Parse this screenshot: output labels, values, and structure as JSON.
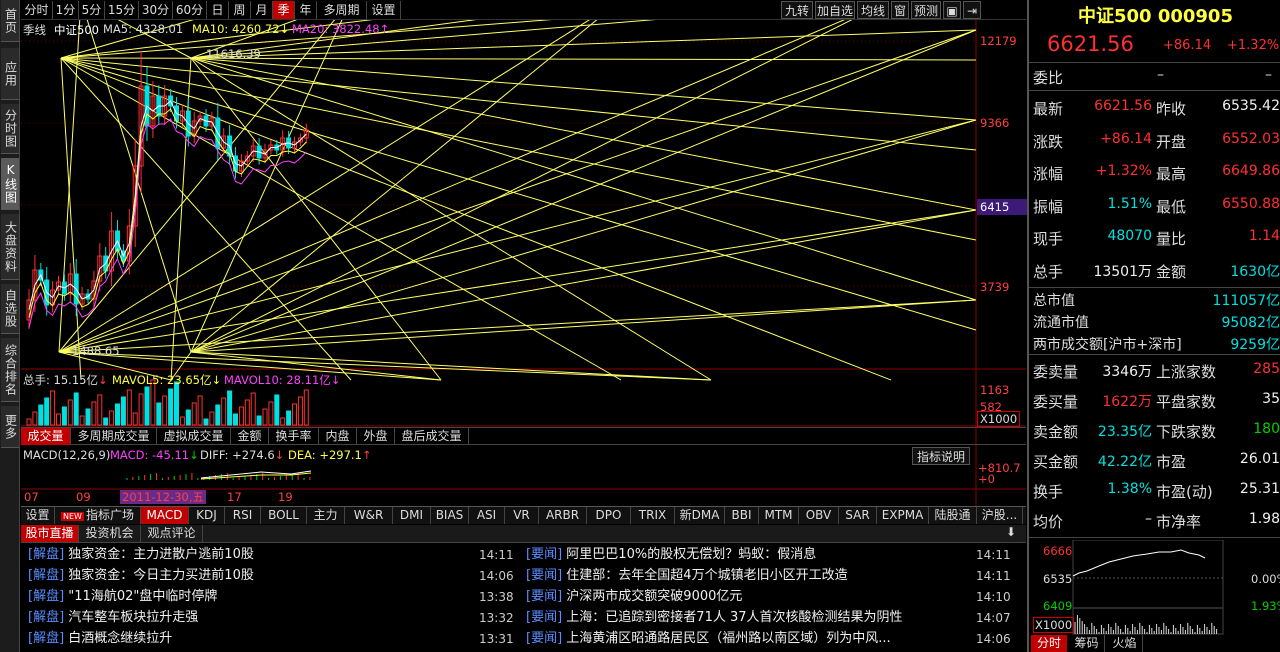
{
  "left_rail": {
    "tabs": [
      "首页",
      "应用",
      "分时图",
      "K线图",
      "大盘资料",
      "自选股",
      "综合排名",
      "更多"
    ]
  },
  "periods": [
    "分时",
    "1分",
    "5分",
    "15分",
    "30分",
    "60分",
    "日",
    "周",
    "月",
    "季",
    "年",
    "多周期",
    "设置"
  ],
  "active_period": "季",
  "toolbar_right": [
    "九转",
    "加自选",
    "均线",
    "窗",
    "预测"
  ],
  "chart": {
    "prefix": "季线",
    "name": "中证500",
    "ma5": "MA5: 4328.01",
    "ma10": "MA10: 4260.72",
    "ma20": "MA20: 3822.48",
    "high_label": "11616.39",
    "low_label": "1488.65",
    "price_axis": [
      "12179",
      "9366",
      "6415",
      "3739"
    ],
    "vol_sum": "总手: 15.15亿",
    "mavol5": "MAVOL5: 23.65亿",
    "mavol10": "MAVOL10: 28.11亿",
    "vol_axis": [
      "1163",
      "582"
    ],
    "vol_unit": "X1000",
    "macd_label": "MACD(12,26,9)",
    "macd_val": "MACD: -45.11",
    "diff_val": "DIFF: +274.6",
    "dea_val": "DEA: +297.1",
    "macd_axis_top": "+810.7",
    "macd_axis_zero": "+0",
    "indicator_explain": "指标说明",
    "date_ticks": [
      "07",
      "09",
      "17",
      "19"
    ],
    "cursor_date": "2011-12-30,五"
  },
  "vol_tabs": [
    "成交量",
    "多周期成交量",
    "虚拟成交量",
    "金额",
    "换手率",
    "内盘",
    "外盘",
    "盘后成交量"
  ],
  "indicator_tabs": [
    "设置",
    "指标广场",
    "MACD",
    "KDJ",
    "RSI",
    "BOLL",
    "主力",
    "W&R",
    "DMI",
    "BIAS",
    "ASI",
    "VR",
    "ARBR",
    "DPO",
    "TRIX",
    "新DMA",
    "BBI",
    "MTM",
    "OBV",
    "SAR",
    "EXPMA",
    "陆股通",
    "沪股..."
  ],
  "new_badge": "NEW",
  "news_tabs": [
    "股市直播",
    "投资机会",
    "观点评论"
  ],
  "news_left": [
    {
      "cat": "[解盘]",
      "title": "独家资金：主力进散户逃前10股",
      "time": "14:11"
    },
    {
      "cat": "[解盘]",
      "title": "独家资金：今日主力买进前10股",
      "time": "14:06"
    },
    {
      "cat": "[解盘]",
      "title": "\"11海航02\"盘中临时停牌",
      "time": "13:38"
    },
    {
      "cat": "[解盘]",
      "title": "汽车整车板块拉升走强",
      "time": "13:32"
    },
    {
      "cat": "[解盘]",
      "title": "白酒概念继续拉升",
      "time": "13:31"
    }
  ],
  "news_right": [
    {
      "cat": "[要闻]",
      "title": "阿里巴巴10%的股权无偿划？蚂蚁：假消息",
      "time": "14:11"
    },
    {
      "cat": "[要闻]",
      "title": "住建部：去年全国超4万个城镇老旧小区开工改造",
      "time": "14:11"
    },
    {
      "cat": "[要闻]",
      "title": "沪深两市成交额突破9000亿元",
      "time": "14:10"
    },
    {
      "cat": "[要闻]",
      "title": "上海：已追踪到密接者71人 37人首次核酸检测结果为阴性",
      "time": "14:07"
    },
    {
      "cat": "[要闻]",
      "title": "上海黄浦区昭通路居民区（福州路以南区域）列为中风...",
      "time": "14:06"
    }
  ],
  "quote": {
    "title": "中证500 000905",
    "price": "6621.56",
    "change": "+86.14",
    "pct": "+1.32%",
    "weibi_label": "委比",
    "weibi_val": "–",
    "weibi_val2": "–",
    "rows": [
      {
        "l1": "最新",
        "v1": "6621.56",
        "c1": "red",
        "l2": "昨收",
        "v2": "6535.42",
        "c2": "white"
      },
      {
        "l1": "涨跌",
        "v1": "+86.14",
        "c1": "red",
        "l2": "开盘",
        "v2": "6552.03",
        "c2": "red"
      },
      {
        "l1": "涨幅",
        "v1": "+1.32%",
        "c1": "red",
        "l2": "最高",
        "v2": "6649.86",
        "c2": "red"
      },
      {
        "l1": "振幅",
        "v1": "1.51%",
        "c1": "cyan",
        "l2": "最低",
        "v2": "6550.88",
        "c2": "red"
      },
      {
        "l1": "现手",
        "v1": "48070",
        "c1": "cyan",
        "l2": "量比",
        "v2": "1.14",
        "c2": "red"
      },
      {
        "l1": "总手",
        "v1": "13501万",
        "c1": "white",
        "l2": "金额",
        "v2": "1630亿",
        "c2": "cyan"
      }
    ],
    "market": [
      {
        "l": "总市值",
        "v": "111057亿"
      },
      {
        "l": "流通市值",
        "v": "95082亿"
      },
      {
        "l": "两市成交额[沪市+深市]",
        "v": "9259亿"
      }
    ],
    "rows2": [
      {
        "l1": "委卖量",
        "v1": "3346万",
        "c1": "white",
        "l2": "上涨家数",
        "v2": "285",
        "c2": "red"
      },
      {
        "l1": "委买量",
        "v1": "1622万",
        "c1": "red",
        "l2": "平盘家数",
        "v2": "35",
        "c2": "white"
      },
      {
        "l1": "卖金额",
        "v1": "23.35亿",
        "c1": "cyan",
        "l2": "下跌家数",
        "v2": "180",
        "c2": "green"
      },
      {
        "l1": "买金额",
        "v1": "42.22亿",
        "c1": "cyan",
        "l2": "市盈",
        "v2": "26.01",
        "c2": "white"
      },
      {
        "l1": "换手",
        "v1": "1.38%",
        "c1": "cyan",
        "l2": "市盈(动)",
        "v2": "25.31",
        "c2": "white"
      },
      {
        "l1": "均价",
        "v1": "–",
        "c1": "white",
        "l2": "市净率",
        "v2": "1.98",
        "c2": "white"
      }
    ],
    "mini_top": "6666",
    "mini_mid": "6535",
    "mini_bot": "6409",
    "mini_pct_mid": "0.00%",
    "mini_pct_bot": "1.93%",
    "mini_unit": "X1000",
    "mini_tabs": [
      "分时",
      "筹码",
      "火焰"
    ]
  },
  "colors": {
    "up": "#ff3030",
    "down": "#00e0e0",
    "gann": "#ffff66",
    "accent": "#c00000"
  }
}
